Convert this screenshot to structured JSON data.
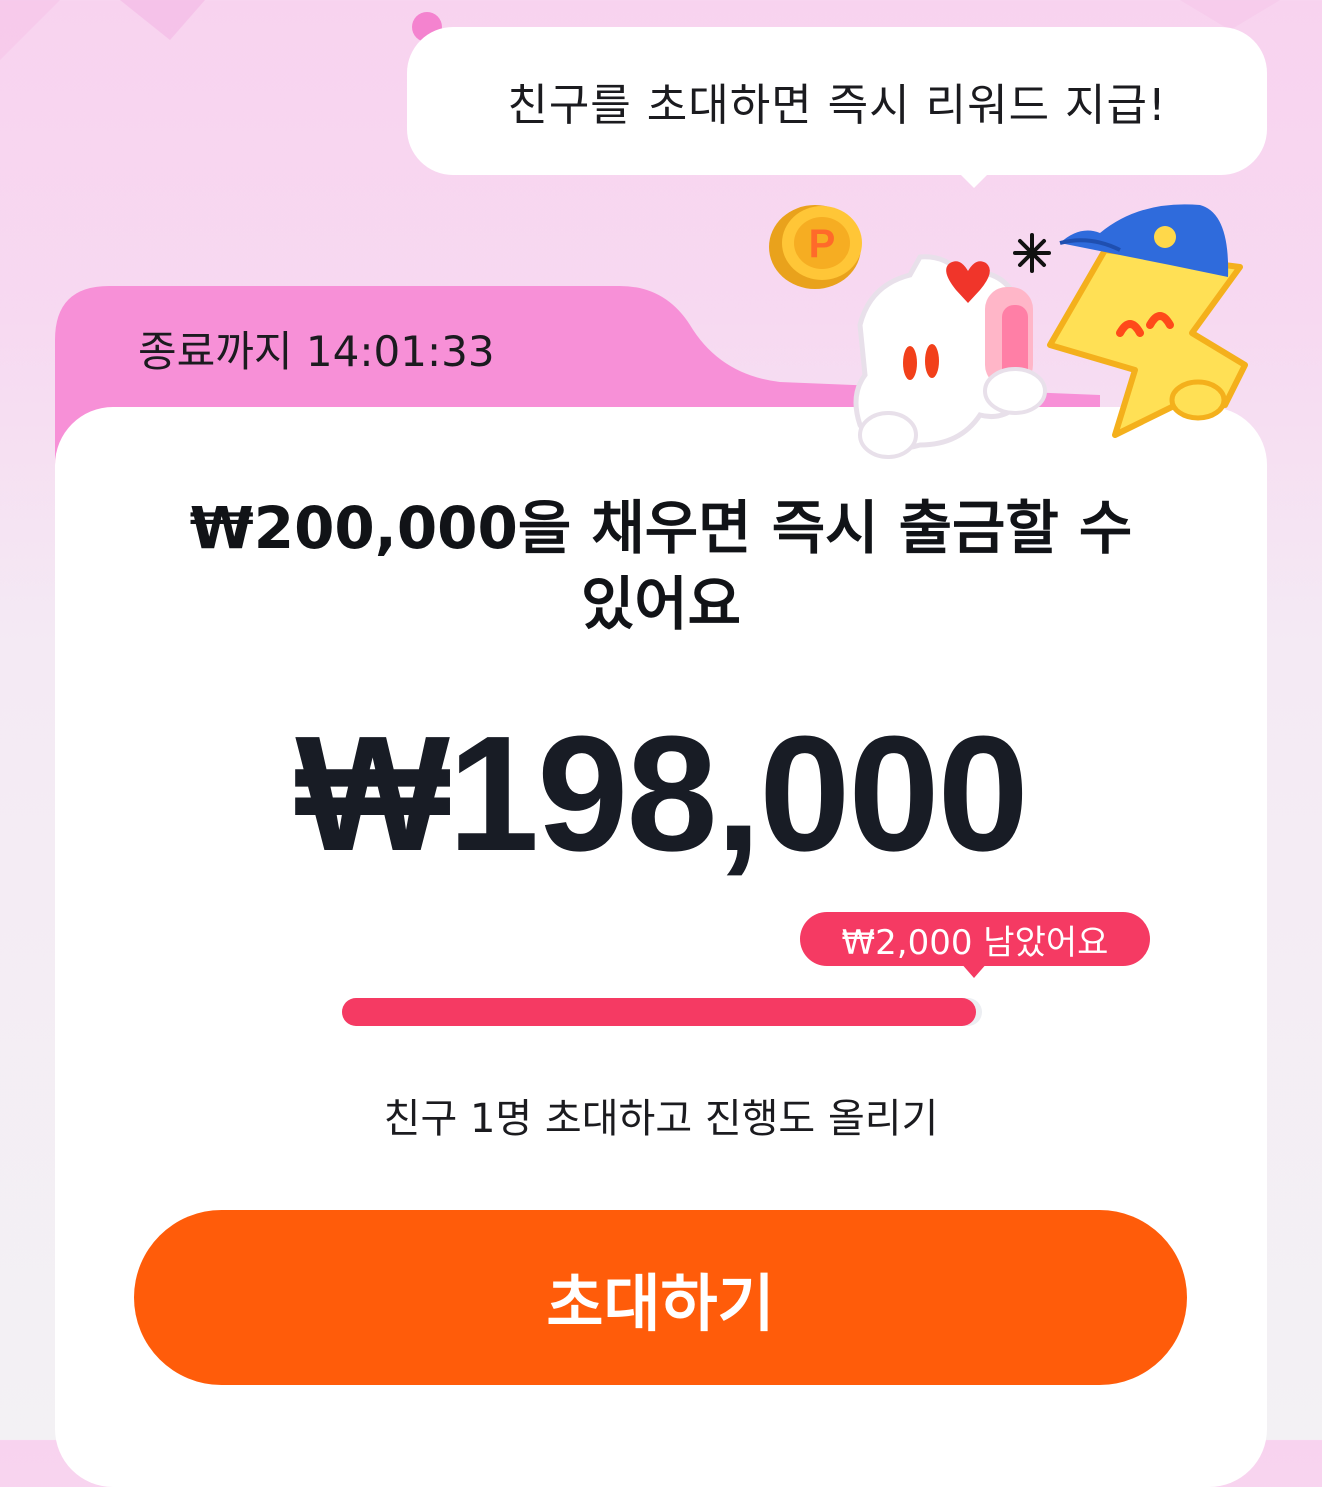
{
  "banner": {
    "speech_text": "친구를 초대하면 즉시 리워드 지급!"
  },
  "timer": {
    "text": "종료까지 14:01:33"
  },
  "goal": {
    "headline_line1": "₩200,000을 채우면 즉시 출금할 수",
    "headline_line2": "있어요"
  },
  "balance": {
    "amount_text": "₩198,000"
  },
  "progress": {
    "remaining_text": "₩2,000 남았어요",
    "current": 198000,
    "target": 200000,
    "fill_fraction": 0.99
  },
  "invite": {
    "hint": "친구 1명 초대하고 진행도 올리기",
    "button_label": "초대하기"
  },
  "illustration": {
    "coin_letter": "P",
    "icons": [
      "coin-icon",
      "sparkle-icon",
      "ghost-character-icon",
      "heart-icon",
      "lightning-character-icon",
      "blue-cap-icon"
    ]
  },
  "colors": {
    "tab_pink": "#f790d7",
    "accent_red": "#f53a63",
    "button_orange": "#ff5c0a",
    "amount_text": "#181c25"
  }
}
